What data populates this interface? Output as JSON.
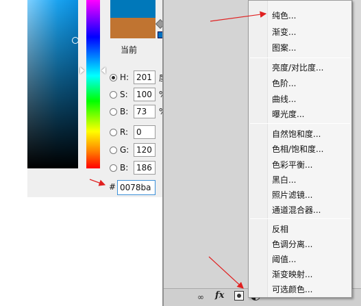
{
  "color_picker": {
    "current_label": "当前",
    "new_color": "#0078ba",
    "current_color": "#c07431",
    "hsb": [
      {
        "label": "H:",
        "value": "201",
        "unit": "度",
        "checked": true
      },
      {
        "label": "S:",
        "value": "100",
        "unit": "%",
        "checked": false
      },
      {
        "label": "B:",
        "value": "73",
        "unit": "%",
        "checked": false
      }
    ],
    "rgb": [
      {
        "label": "R:",
        "value": "0"
      },
      {
        "label": "G:",
        "value": "120"
      },
      {
        "label": "B:",
        "value": "186"
      }
    ],
    "hex_prefix": "#",
    "hex_value": "0078ba"
  },
  "adjustment_menu": {
    "group1": [
      "纯色...",
      "渐变...",
      "图案..."
    ],
    "group2": [
      "亮度/对比度...",
      "色阶...",
      "曲线...",
      "曝光度..."
    ],
    "group3": [
      "自然饱和度...",
      "色相/饱和度...",
      "色彩平衡...",
      "黑白...",
      "照片滤镜...",
      "通道混合器..."
    ],
    "group4": [
      "反相",
      "色调分离...",
      "阈值...",
      "渐变映射...",
      "可选颜色..."
    ]
  },
  "layers_bar": {
    "link_icon": "link-icon",
    "fx_label": "fx",
    "mask_icon": "mask-icon",
    "adjustment_icon": "adjustment-layer-icon"
  },
  "annotation_color": "#e02020"
}
